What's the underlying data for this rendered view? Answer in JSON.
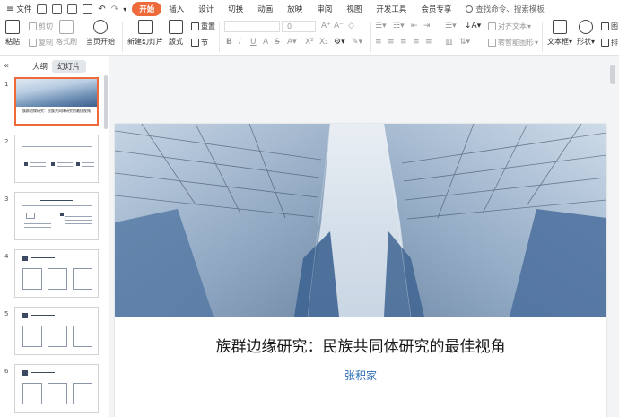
{
  "menubar": {
    "file_label": "文件",
    "tabs": [
      {
        "label": "开始",
        "active": true
      },
      {
        "label": "插入"
      },
      {
        "label": "设计"
      },
      {
        "label": "切换"
      },
      {
        "label": "动画"
      },
      {
        "label": "放映"
      },
      {
        "label": "审阅"
      },
      {
        "label": "视图"
      },
      {
        "label": "开发工具"
      },
      {
        "label": "会员专享"
      }
    ],
    "search_label": "查找命令、搜索模板"
  },
  "ribbon": {
    "paste": "粘贴",
    "cut": "剪切",
    "copy": "复制",
    "format_painter": "格式刷",
    "from_current": "当页开始",
    "new_slide": "新建幻灯片",
    "layout": "版式",
    "section": "节",
    "reset": "重置",
    "font_size": "0",
    "align_text": "对齐文本",
    "smart_graphic": "转智能图形",
    "textbox": "文本框",
    "shape": "形状",
    "arrange": "排",
    "image_label": "图"
  },
  "panel": {
    "tab_outline": "大纲",
    "tab_slides": "幻灯片",
    "thumb_numbers": [
      "1",
      "2",
      "3",
      "4",
      "5",
      "6"
    ]
  },
  "slide": {
    "title": "族群边缘研究：民族共同体研究的最佳视角",
    "author": "张积家"
  },
  "colors": {
    "accent": "#ee6a3a",
    "author_blue": "#2e6fb8"
  }
}
